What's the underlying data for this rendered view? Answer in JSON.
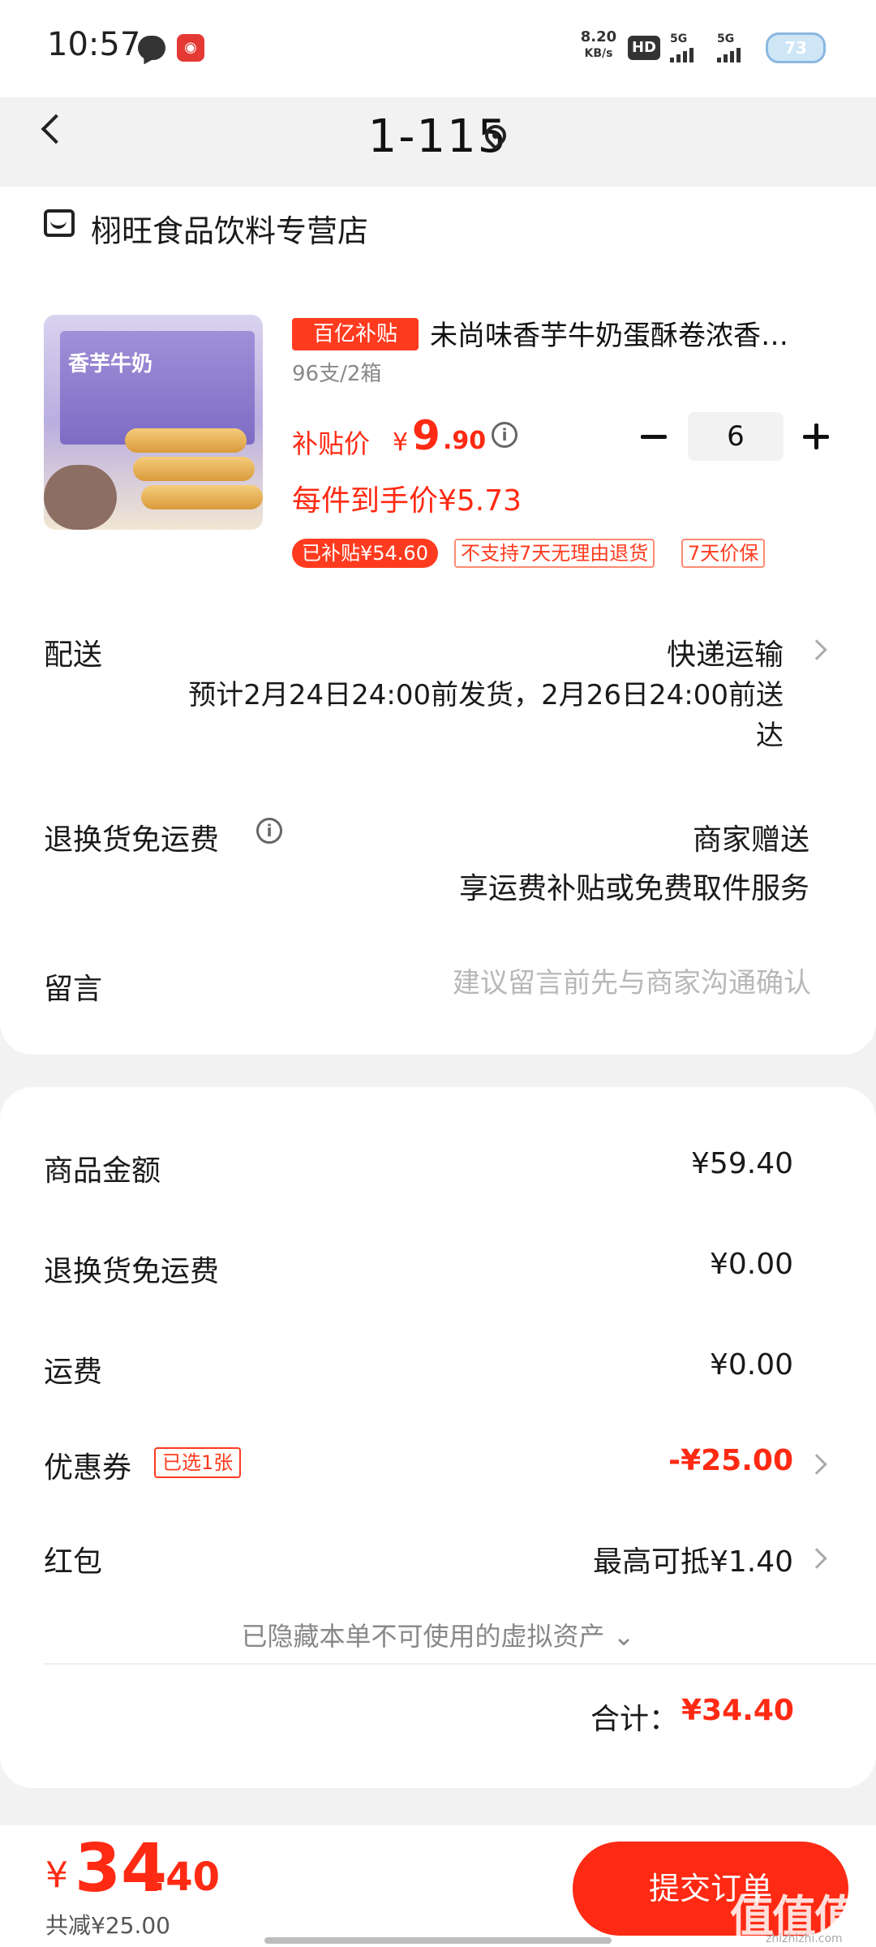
{
  "status_bar": {
    "time": "10:57",
    "net_speed_value": "8.20",
    "net_speed_unit": "KB/s",
    "hd_label": "HD",
    "signal1": "5G",
    "signal2": "5G",
    "battery": "73"
  },
  "header": {
    "title": "1-115"
  },
  "store": {
    "name": "栩旺食品饮料专营店"
  },
  "product": {
    "badge": "百亿补贴",
    "title": "未尚味香芋牛奶蛋酥卷浓香酥脆",
    "spec": "96支/2箱",
    "price_label": "补贴价",
    "price_yen": "¥",
    "price_int": "9",
    "price_dec": ".90",
    "quantity": "6",
    "unit_price": "每件到手价¥5.73",
    "tag_saved": "已补贴¥54.60",
    "tag_no_return": "不支持7天无理由退货",
    "tag_price_protect": "7天价保"
  },
  "shipping": {
    "label": "配送",
    "method": "快递运输",
    "eta": "预计2月24日24:00前发货，2月26日24:00前送达"
  },
  "return_shipping": {
    "label": "退换货免运费",
    "value": "商家赠送",
    "sub": "享运费补贴或免费取件服务"
  },
  "message": {
    "label": "留言",
    "placeholder": "建议留言前先与商家沟通确认"
  },
  "summary": {
    "goods_amount_label": "商品金额",
    "goods_amount": "¥59.40",
    "return_fee_label": "退换货免运费",
    "return_fee": "¥0.00",
    "shipping_fee_label": "运费",
    "shipping_fee": "¥0.00",
    "coupon_label": "优惠券",
    "coupon_tag": "已选1张",
    "coupon_value": "-¥25.00",
    "red_packet_label": "红包",
    "red_packet_value": "最高可抵¥1.40",
    "hidden_note": "已隐藏本单不可使用的虚拟资产 ⌄",
    "total_label": "合计：",
    "total_value": "¥34.40"
  },
  "bottom": {
    "yen": "¥",
    "total_int": "34",
    "total_dec": ".40",
    "saved": "共减¥25.00",
    "submit": "提交订单",
    "watermark": "值值值",
    "watermark_sub": "zhizhizhi.com"
  },
  "colors": {
    "accent": "#ff2a13",
    "tag_red": "#ff3b1f",
    "bg": "#f2f2f2"
  }
}
